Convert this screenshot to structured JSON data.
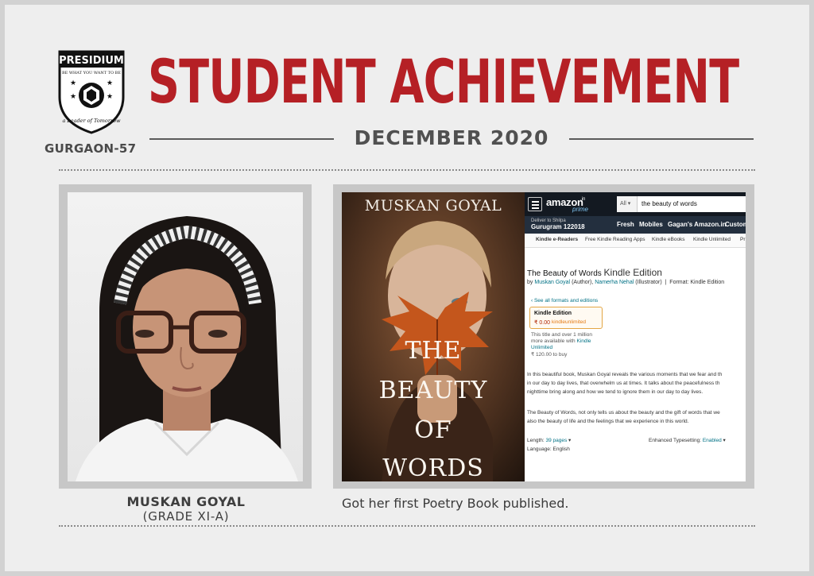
{
  "header": {
    "logo_name": "PRESIDIUM",
    "logo_motto": "BE WHAT YOU WANT TO BE",
    "logo_tagline": "a Leader of Tomorrow",
    "campus": "GURGAON-57",
    "title": "STUDENT ACHIEVEMENT",
    "date": "DECEMBER 2020"
  },
  "student": {
    "name": "MUSKAN GOYAL",
    "grade": "(GRADE XI-A)"
  },
  "achievement": {
    "caption": "Got her first Poetry Book published."
  },
  "book_cover": {
    "author": "MUSKAN GOYAL",
    "title_lines": [
      "THE",
      "BEAUTY",
      "OF",
      "WORDS"
    ]
  },
  "amazon": {
    "logo": "amazon",
    "logo_suffix": ".in",
    "prime": "prime",
    "search_category": "All",
    "search_query": "the beauty of words",
    "deliver_label": "Deliver to Shilpa",
    "deliver_location": "Gurugram 122018",
    "nav": [
      "Fresh",
      "Mobiles",
      "Gagan's Amazon.in",
      "Custom"
    ],
    "subnav": [
      "Kindle e-Readers",
      "Free Kindle Reading Apps",
      "Kindle eBooks",
      "Kindle Unlimited",
      "Pr"
    ],
    "product_title": "The Beauty of Words",
    "product_edition": "Kindle Edition",
    "by_prefix": "by",
    "author_link": "Muskan Goyal",
    "author_role": "(Author),",
    "illustrator_link": "Namerha Nehal",
    "illustrator_role": "(Illustrator)",
    "format": "Format: Kindle Edition",
    "see_formats": "‹ See all formats and editions",
    "kindle_label": "Kindle Edition",
    "kindle_price": "₹ 0.00",
    "kindle_unlimited": "kindleunlimited",
    "avail_line1": "This title and over 1 million",
    "avail_line2": "more available with",
    "avail_link": "Kindle",
    "avail_link2": "Unlimited",
    "buy_price": "₹ 120.00 to buy",
    "desc1": [
      "In this beautiful book, Muskan Goyal reveals the various moments that we fear and th",
      "in our day to day lives, that overwhelm us at times. It talks about the peacefulness th",
      "nighttime bring along and how we tend to ignore them in our day to day lives."
    ],
    "desc2": [
      "The Beauty of Words, not only tells us about the beauty and the gift of words that we",
      "also the beauty of life and the feelings that we experience in this world."
    ],
    "length_label": "Length:",
    "length_value": "39 pages",
    "typesetting_label": "Enhanced Typesetting:",
    "typesetting_value": "Enabled",
    "language": "Language: English"
  },
  "colors": {
    "title_red": "#b52025",
    "text_gray": "#4a4a4a",
    "amazon_dark": "#131921"
  }
}
